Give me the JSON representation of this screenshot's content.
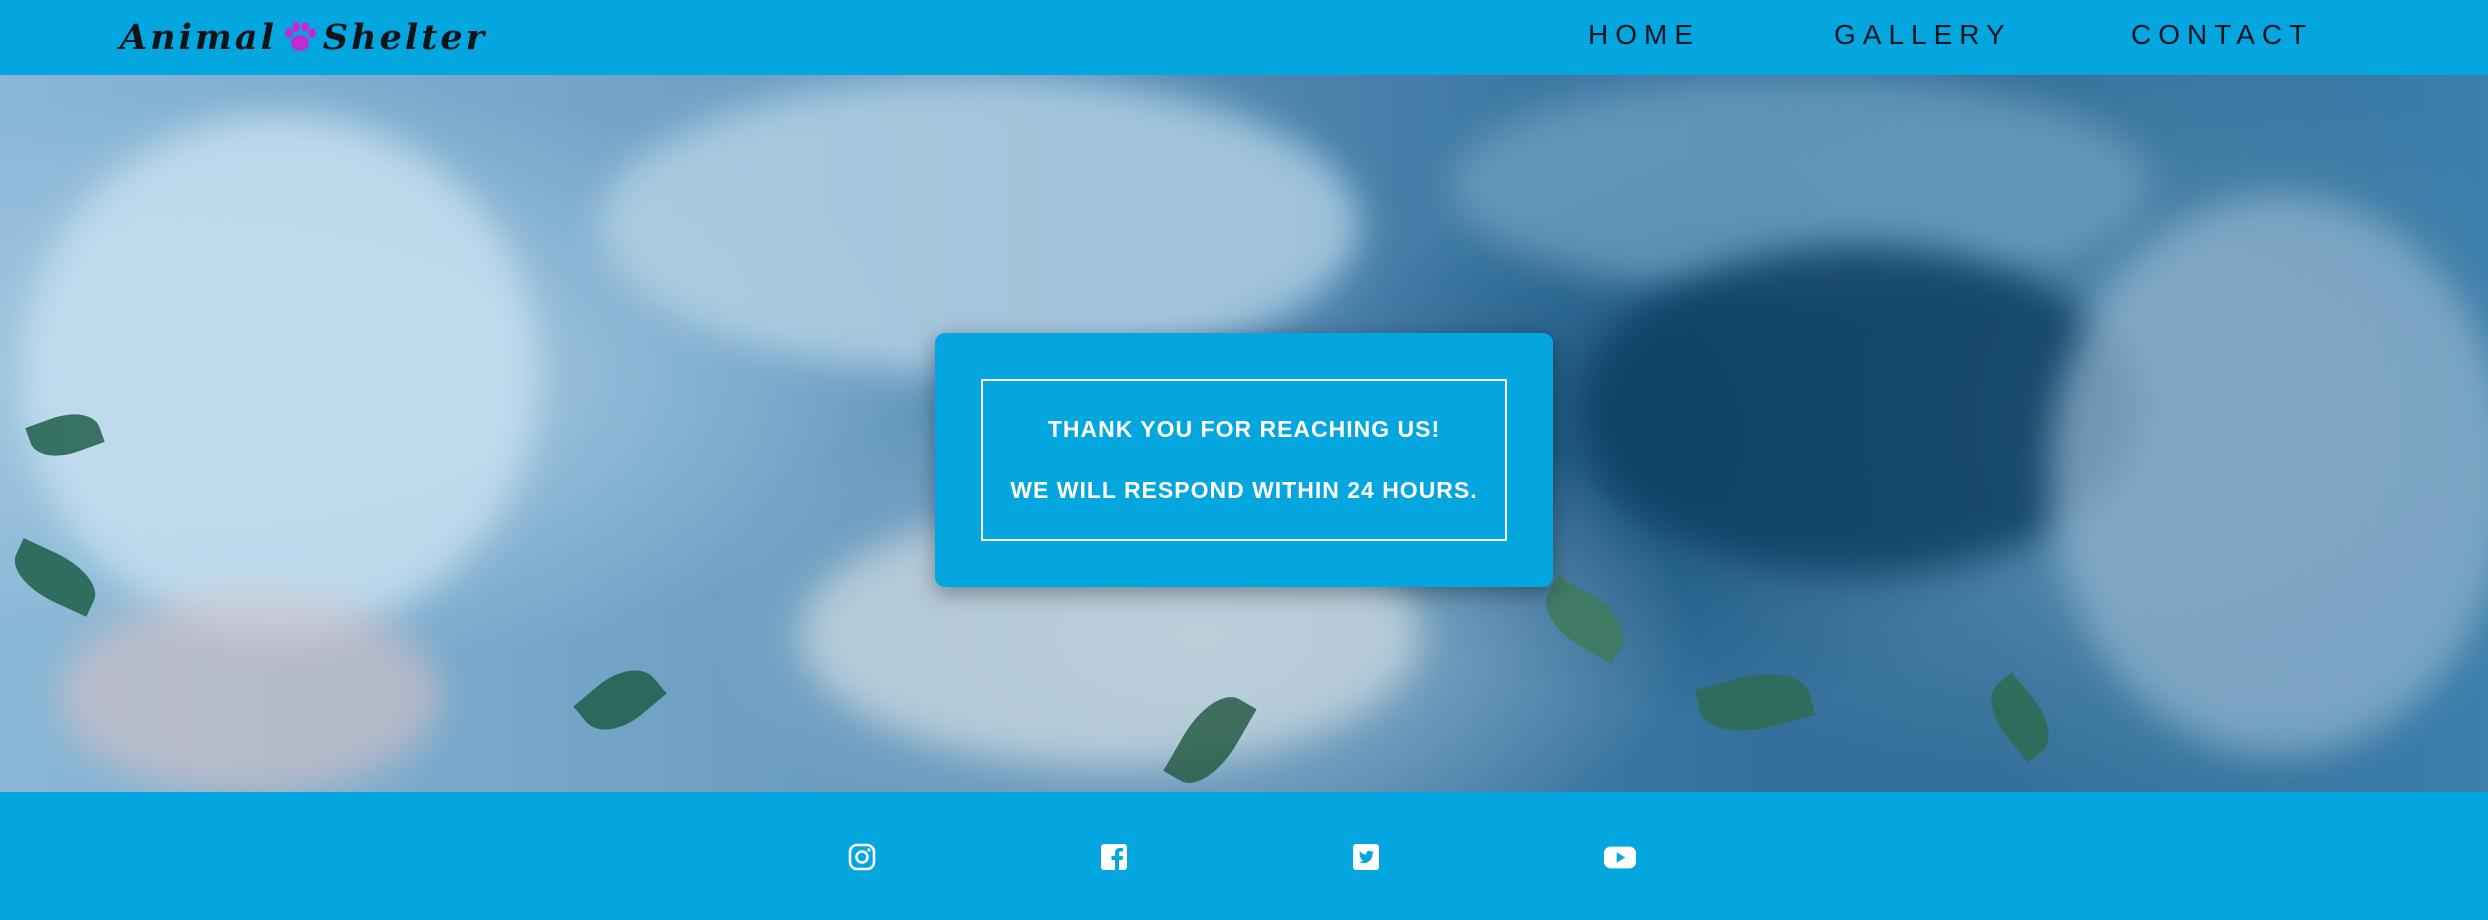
{
  "header": {
    "logo_left": "Animal",
    "logo_right": "Shelter",
    "logo_icon": "paw-icon",
    "nav": {
      "home": "HOME",
      "gallery": "GALLERY",
      "contact": "CONTACT"
    }
  },
  "message": {
    "line1": "THANK YOU FOR REACHING US!",
    "line2": "WE WILL RESPOND WITHIN 24 HOURS."
  },
  "footer": {
    "icons": [
      "instagram-icon",
      "facebook-icon",
      "twitter-icon",
      "youtube-icon"
    ]
  },
  "colors": {
    "brand": "#03a6df",
    "paw": "#c02bd6",
    "text_dark": "#101418",
    "text_light": "#ffffff"
  }
}
